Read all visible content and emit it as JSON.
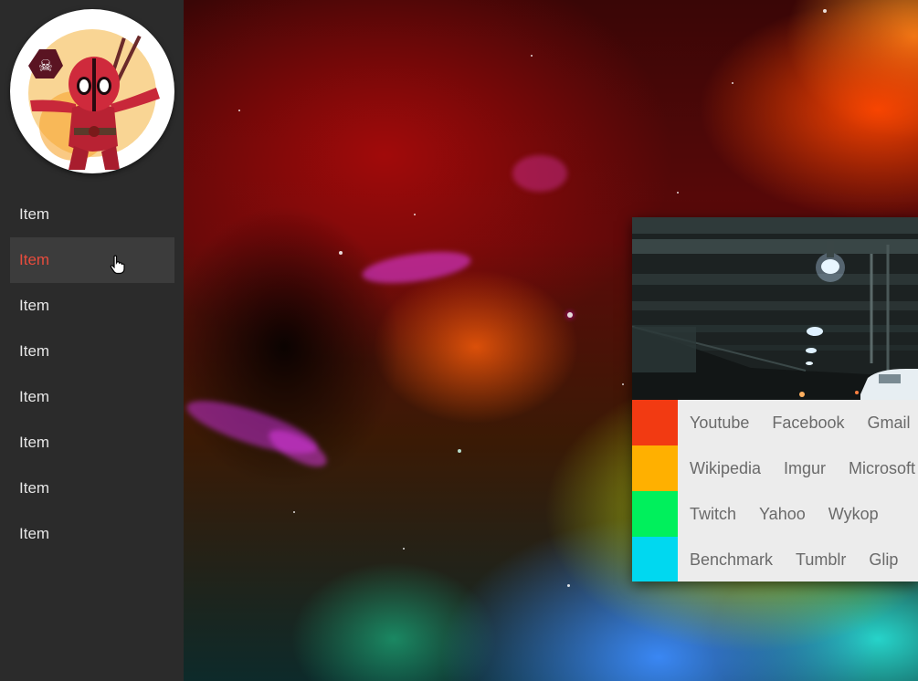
{
  "sidebar": {
    "avatar_icon": "deadpool-avatar-icon",
    "items": [
      {
        "label": "Item",
        "active": false
      },
      {
        "label": "Item",
        "active": true
      },
      {
        "label": "Item",
        "active": false
      },
      {
        "label": "Item",
        "active": false
      },
      {
        "label": "Item",
        "active": false
      },
      {
        "label": "Item",
        "active": false
      },
      {
        "label": "Item",
        "active": false
      },
      {
        "label": "Item",
        "active": false
      }
    ],
    "active_color": "#e84c3d",
    "background": "#2b2b2b"
  },
  "launcher": {
    "image_icon": "parking-garage-image",
    "rows": [
      {
        "color": "#f23a12",
        "links": [
          "Youtube",
          "Facebook",
          "Gmail"
        ]
      },
      {
        "color": "#ffb000",
        "links": [
          "Wikipedia",
          "Imgur",
          "Microsoft"
        ]
      },
      {
        "color": "#00f05c",
        "links": [
          "Twitch",
          "Yahoo",
          "Wykop"
        ]
      },
      {
        "color": "#00d8f0",
        "links": [
          "Benchmark",
          "Tumblr",
          "Glip"
        ]
      }
    ]
  }
}
